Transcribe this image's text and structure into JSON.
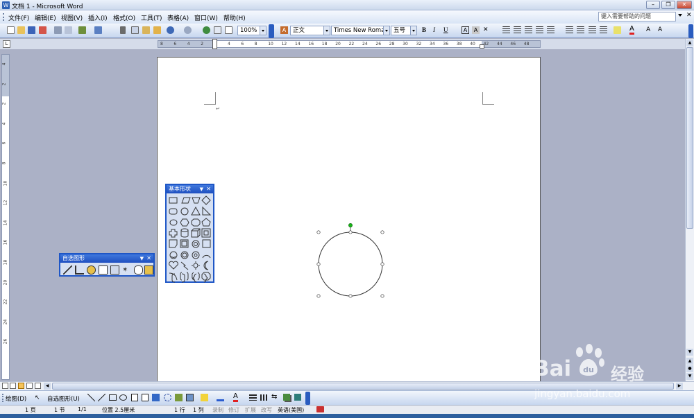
{
  "window": {
    "title": "文档 1 - Microsoft Word"
  },
  "menu": [
    "文件(F)",
    "编辑(E)",
    "视图(V)",
    "插入(I)",
    "格式(O)",
    "工具(T)",
    "表格(A)",
    "窗口(W)",
    "帮助(H)"
  ],
  "help_placeholder": "键入需要帮助的问题",
  "formatting": {
    "zoom": "100%",
    "style": "正文",
    "font": "Times New Roman",
    "size": "五号"
  },
  "ruler": {
    "h_labels": [
      "8",
      "6",
      "4",
      "2",
      "2",
      "4",
      "6",
      "8",
      "10",
      "12",
      "14",
      "16",
      "18",
      "20",
      "22",
      "24",
      "26",
      "28",
      "30",
      "32",
      "34",
      "36",
      "38",
      "40",
      "42",
      "44",
      "46",
      "48"
    ],
    "v_labels": [
      "4",
      "2",
      "2",
      "4",
      "6",
      "8",
      "10",
      "12",
      "14",
      "16",
      "18",
      "20",
      "22",
      "24",
      "26"
    ]
  },
  "autoshape_toolbar": {
    "title": "自选图形"
  },
  "basic_shapes_palette": {
    "title": "基本形状"
  },
  "drawing_toolbar": {
    "draw_label": "绘图(D)",
    "autoshapes_label": "自选图形(U)"
  },
  "status": {
    "page": "1 页",
    "section": "1 节",
    "pages": "1/1",
    "position": "位置 2.5厘米",
    "line": "1 行",
    "column": "1 列",
    "rec": "录制",
    "trk": "修订",
    "ext": "扩展",
    "ovr": "改写",
    "language": "英语(美国)"
  },
  "watermark": {
    "brand": "Bai",
    "brand2": "du",
    "cn": "经验",
    "url": "jingyan.baidu.com"
  },
  "colors": {
    "palette_border": "#1e56c6",
    "selection_handle_green": "#18b418",
    "page_bg": "#ffffff",
    "workspace": "#abb1c6"
  }
}
